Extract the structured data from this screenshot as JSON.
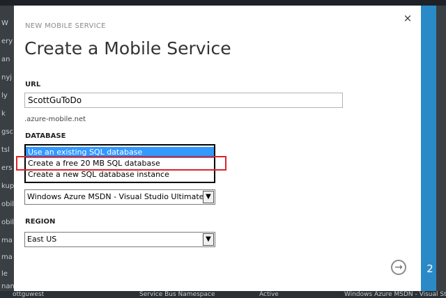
{
  "dialog": {
    "eyebrow": "NEW MOBILE SERVICE",
    "title": "Create a Mobile Service",
    "close_glyph": "×",
    "step": "2",
    "next_glyph": "→"
  },
  "url": {
    "label": "URL",
    "value": "ScottGuToDo",
    "suffix": ".azure-mobile.net"
  },
  "database": {
    "label": "DATABASE",
    "options": [
      "Use an existing SQL database",
      "Create a free 20 MB SQL database",
      "Create a new SQL database instance"
    ],
    "selected_index": 0,
    "highlighted_index": 1
  },
  "subscription": {
    "value": "Windows Azure MSDN - Visual Studio Ultimate"
  },
  "region": {
    "label": "REGION",
    "value": "East US"
  },
  "background": {
    "left_fragments": [
      "W",
      "ery",
      "an",
      "nyj",
      "ly",
      "k",
      "gsc",
      "tsl",
      "ers",
      "kup",
      "obil",
      "obil",
      "ma",
      "ma",
      "le",
      "nan"
    ],
    "bottom_items": [
      "ottguwest",
      "Service Bus Namespace",
      "Active",
      "Windows Azure MSDN - Visual Studio..."
    ]
  },
  "colors": {
    "accent_blue": "#2a8ac8",
    "selection_blue": "#3399ff",
    "highlight_red": "#d9242b"
  }
}
